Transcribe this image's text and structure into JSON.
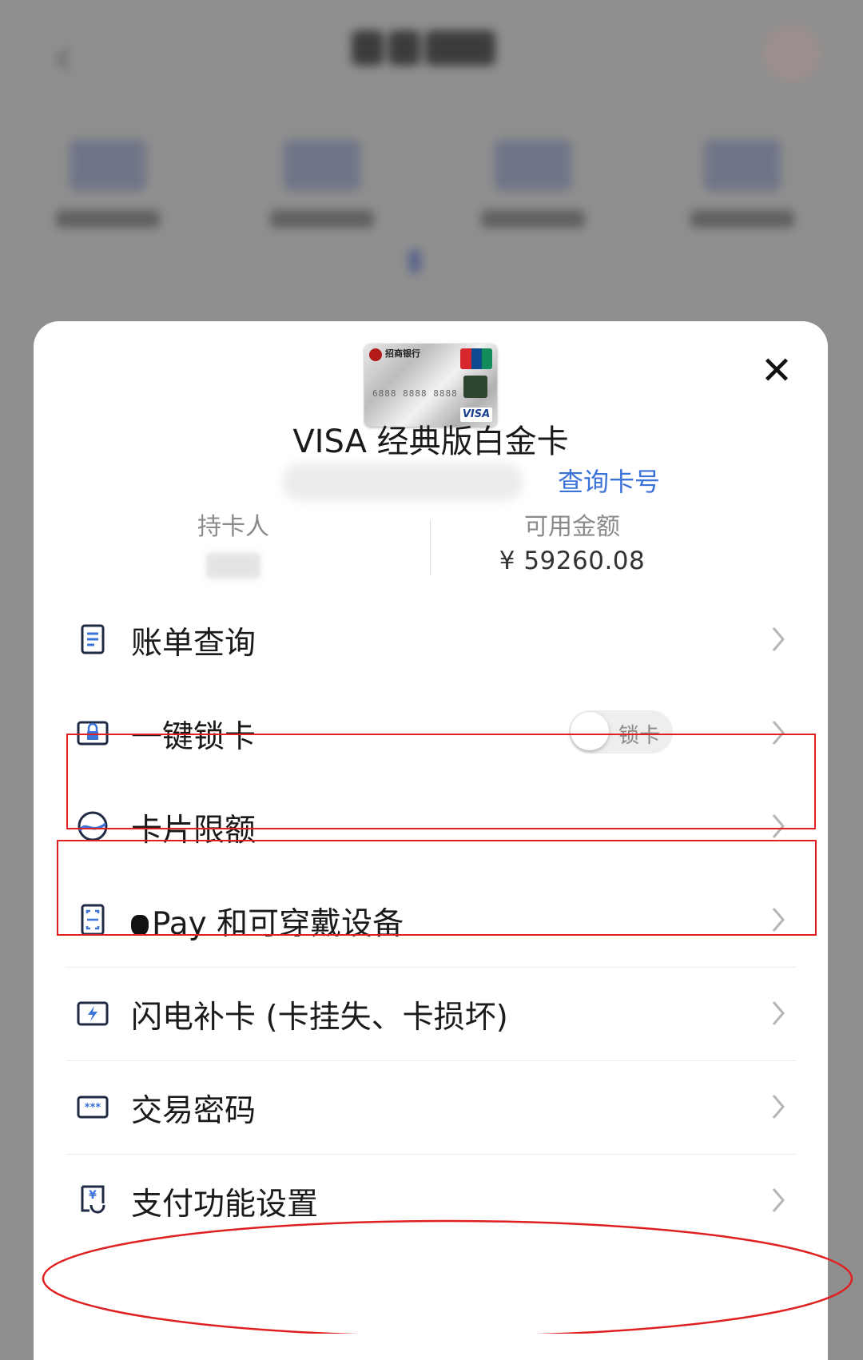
{
  "card": {
    "logo_text": "招商银行",
    "number_text": "6888 8888 8888",
    "brand": "VISA",
    "name": "VISA 经典版白金卡",
    "query_number_label": "查询卡号",
    "holder_label": "持卡人",
    "balance_label": "可用金额",
    "balance_value": "¥ 59260.08"
  },
  "close_icon": "close-icon",
  "menu": {
    "items": [
      {
        "label": "账单查询",
        "icon": "bill-icon"
      },
      {
        "label": "一键锁卡",
        "icon": "lock-card-icon",
        "toggle_label": "锁卡",
        "toggle_on": false
      },
      {
        "label": "卡片限额",
        "icon": "limit-icon"
      },
      {
        "label": "Pay 和可穿戴设备",
        "icon": "wearable-icon",
        "apple_glyph": ""
      },
      {
        "label": "闪电补卡 (卡挂失、卡损坏)",
        "icon": "flash-card-icon"
      },
      {
        "label": "交易密码",
        "icon": "password-icon"
      },
      {
        "label": "支付功能设置",
        "icon": "payment-settings-icon"
      }
    ]
  },
  "colors": {
    "accent_link": "#3b73d8",
    "annotation": "#e02020",
    "overlay": "#8f8f8f"
  }
}
